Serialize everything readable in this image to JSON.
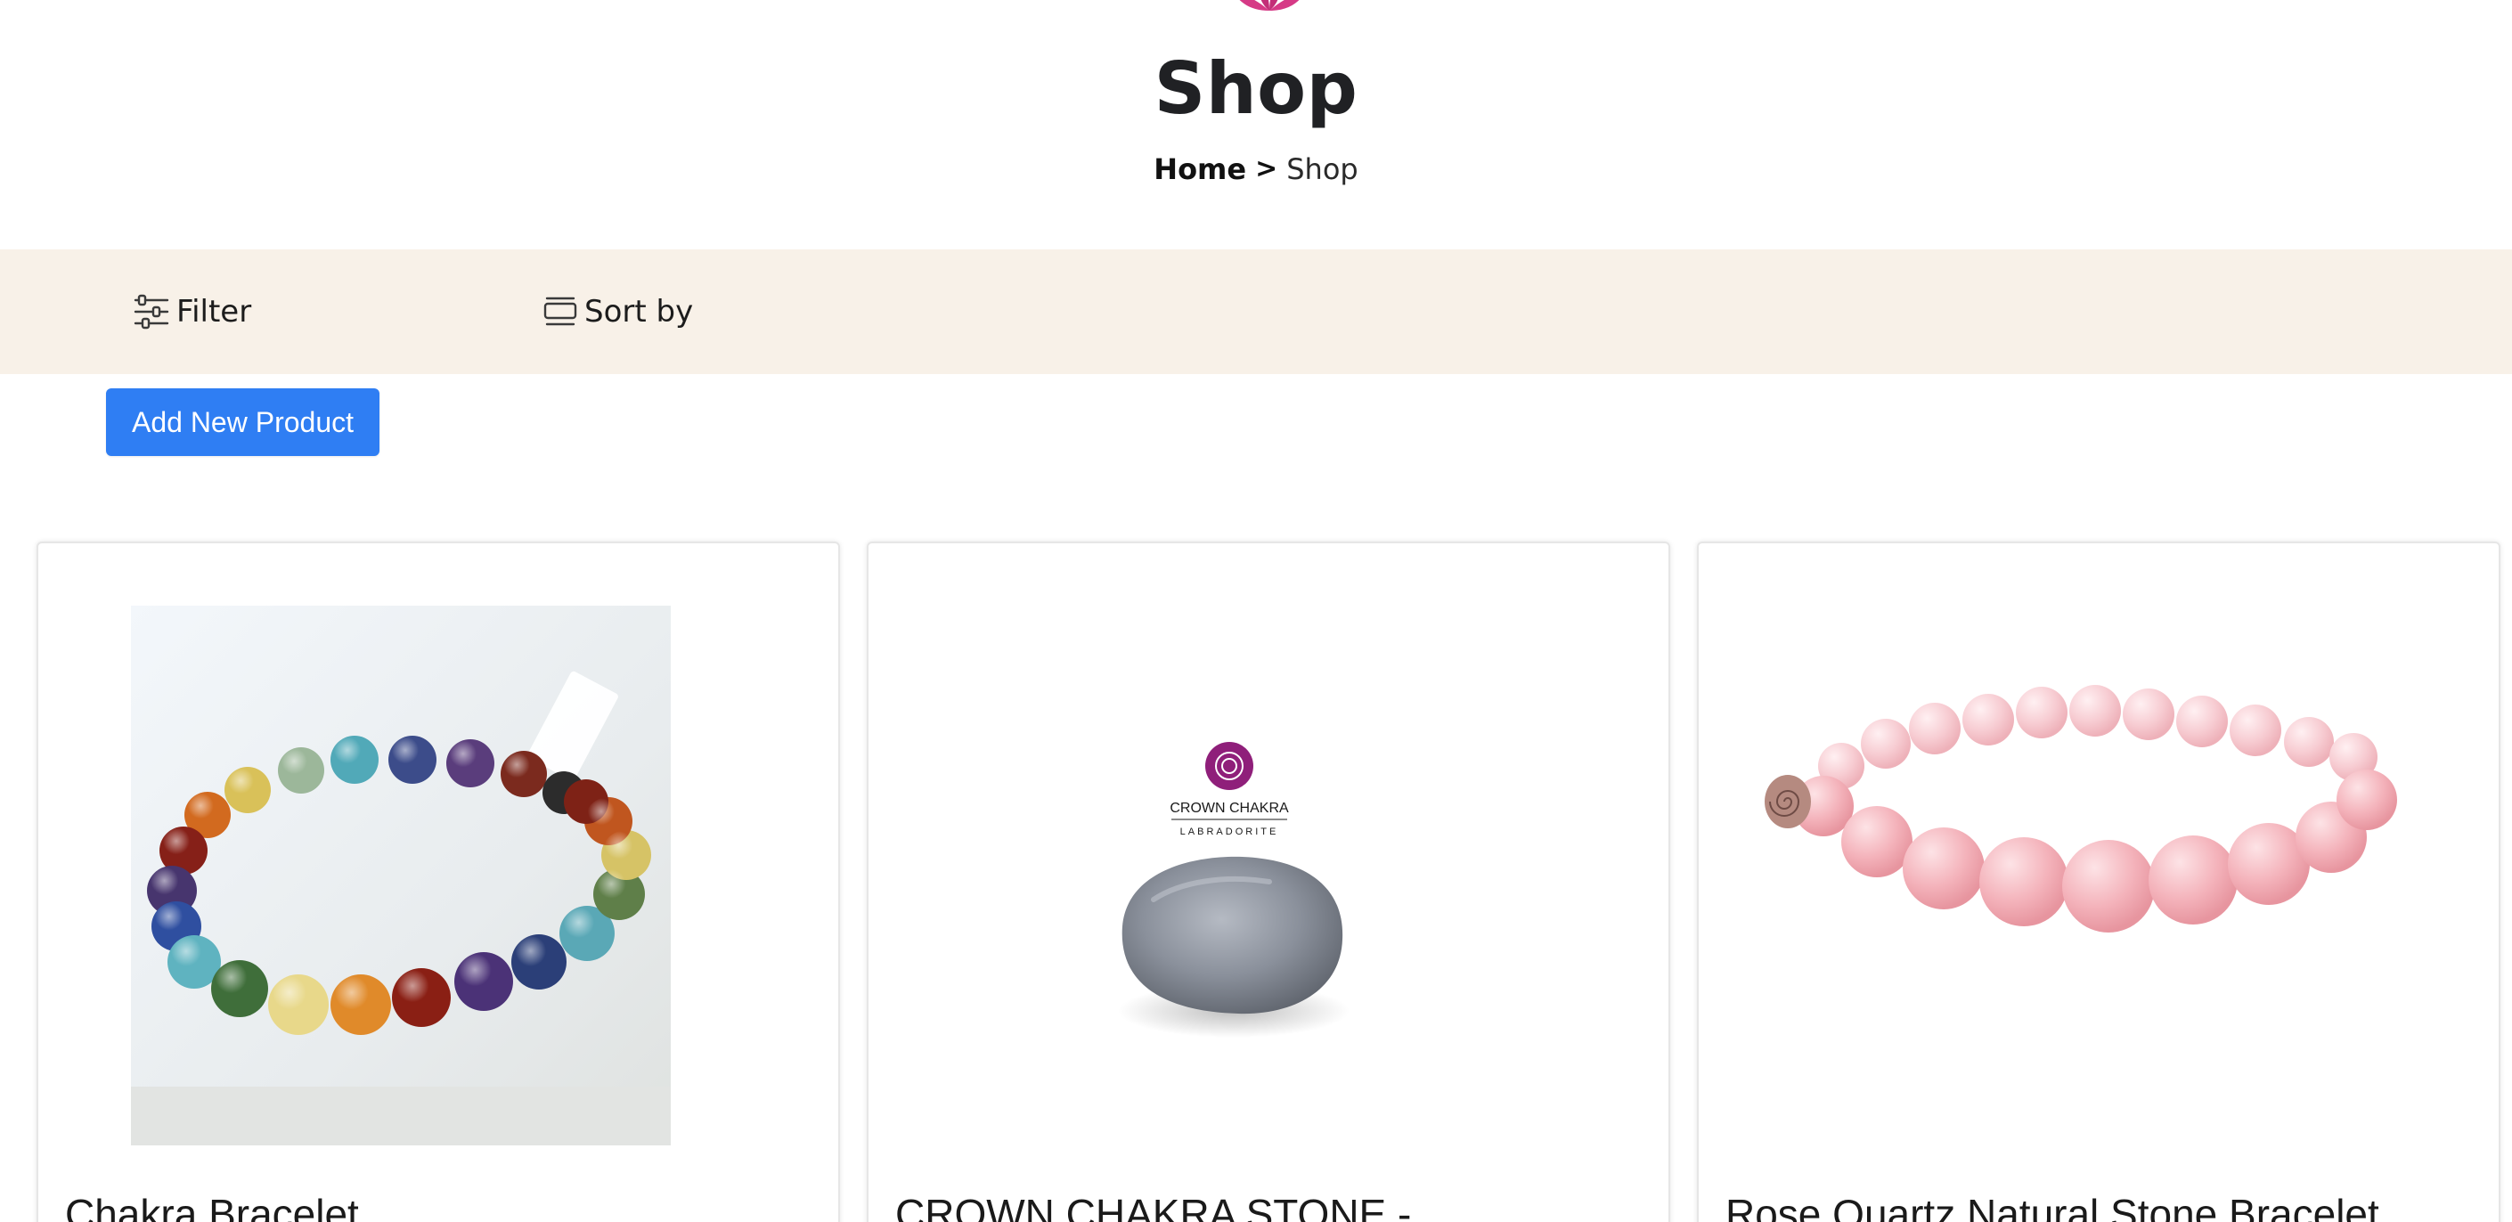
{
  "page": {
    "title": "Shop"
  },
  "breadcrumb": {
    "home": "Home",
    "separator": ">",
    "current": "Shop"
  },
  "toolbar": {
    "filter_label": "Filter",
    "filter_icon": "sliders-icon",
    "sort_label": "Sort by",
    "sort_icon": "sort-icon"
  },
  "actions": {
    "add_product_label": "Add New Product"
  },
  "colors": {
    "accent": "#2f7ef3",
    "toolbar_bg": "#f8f1e8",
    "logo": "#d63a86"
  },
  "products": [
    {
      "title": "Chakra Bracelet",
      "image": "chakra-bracelet-image"
    },
    {
      "title": "CROWN CHAKRA STONE -",
      "image": "crown-chakra-labradorite-image",
      "image_text": {
        "heading": "CROWN CHAKRA",
        "subheading": "LABRADORITE"
      }
    },
    {
      "title": "Rose Quartz Natural Stone Bracelet",
      "image": "rose-quartz-bracelet-image"
    }
  ]
}
